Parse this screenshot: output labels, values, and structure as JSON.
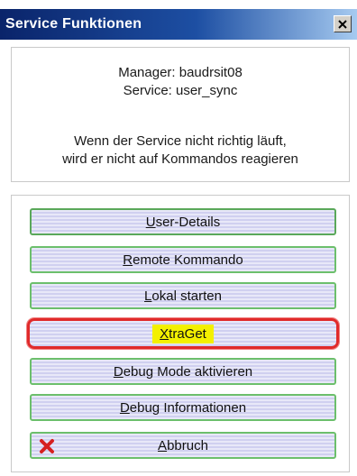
{
  "window": {
    "title": "Service Funktionen",
    "close_label": "close"
  },
  "info": {
    "manager": "Manager: baudrsit08",
    "service": "Service: user_sync",
    "hint_line1": "Wenn der Service nicht richtig läuft,",
    "hint_line2": "wird er nicht auf Kommandos reagieren"
  },
  "buttons": [
    {
      "id": "user-details",
      "first": "U",
      "rest": "ser-Details"
    },
    {
      "id": "remote-kommando",
      "first": "R",
      "rest": "emote Kommando"
    },
    {
      "id": "lokal-starten",
      "first": "L",
      "rest": "okal starten"
    },
    {
      "id": "xtraget",
      "first": "X",
      "rest": "traGet"
    },
    {
      "id": "debug-mode",
      "first": "D",
      "rest": "ebug Mode aktivieren"
    },
    {
      "id": "debug-info",
      "first": "D",
      "rest": "ebug Informationen"
    },
    {
      "id": "abbruch",
      "first": "A",
      "rest": "bbruch"
    }
  ],
  "colors": {
    "title_bar": "#0a246a",
    "button_border": "#6cbf6c",
    "highlight_border": "#e02a2a",
    "highlight_fill": "#f3f000",
    "cancel_icon": "#d62020"
  },
  "icons": {
    "close": "close-icon",
    "cancel": "red-x-icon"
  }
}
